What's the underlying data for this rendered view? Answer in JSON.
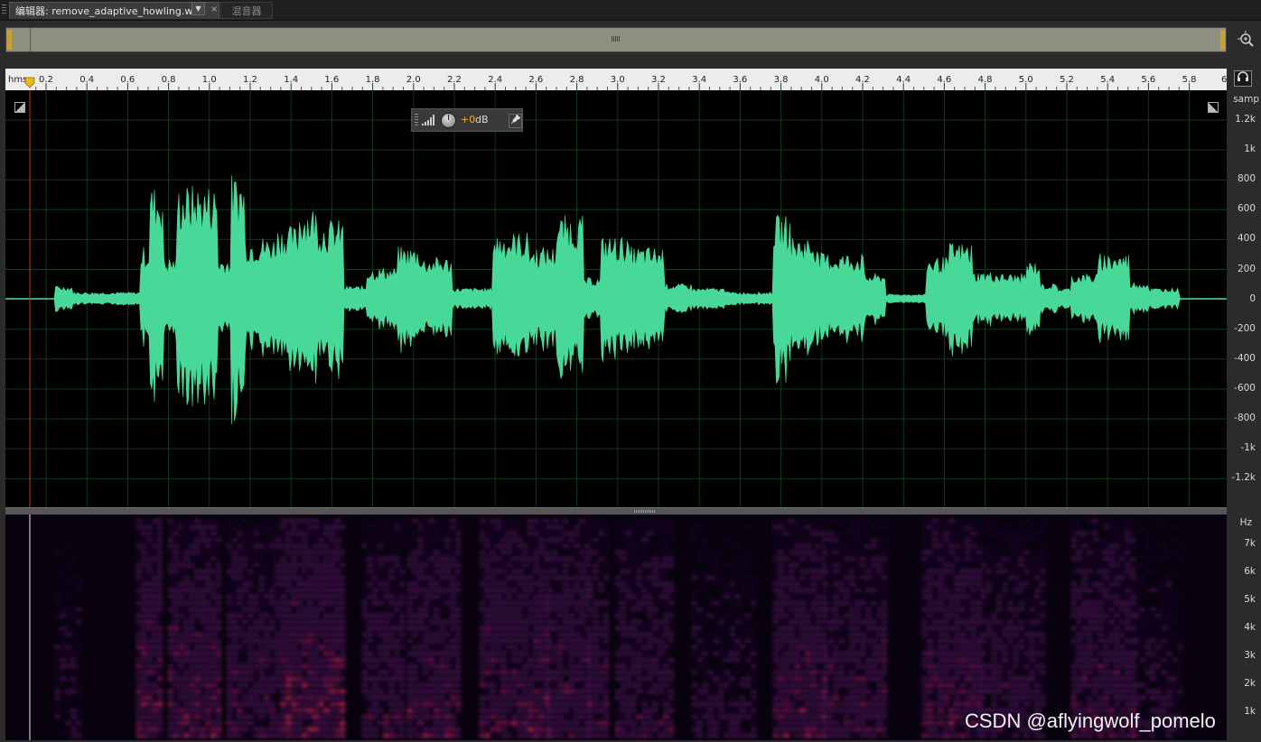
{
  "tabs": {
    "active_label": "编辑器: remove_adaptive_howling.wav",
    "inactive_label": "混音器",
    "dropdown_glyph": "▼",
    "close_glyph": "×"
  },
  "ruler": {
    "unit": "hms",
    "labels": [
      "0.2",
      "0.4",
      "0.6",
      "0.8",
      "1.0",
      "1.2",
      "1.4",
      "1.6",
      "1.8",
      "2.0",
      "2.2",
      "2.4",
      "2.6",
      "2.8",
      "3.0",
      "3.2",
      "3.4",
      "3.6",
      "3.8",
      "4.0",
      "4.2",
      "4.4",
      "4.6",
      "4.8",
      "5.0",
      "5.2",
      "5.4",
      "5.6",
      "5.8"
    ],
    "end_fragment": "6"
  },
  "amplitude_scale": {
    "unit": "samp",
    "labels": [
      "1.2k",
      "1k",
      "800",
      "600",
      "400",
      "200",
      "0",
      "-200",
      "-400",
      "-600",
      "-800",
      "-1k",
      "-1.2k"
    ]
  },
  "frequency_scale": {
    "unit": "Hz",
    "labels": [
      "7k",
      "6k",
      "5k",
      "4k",
      "3k",
      "2k",
      "1k"
    ]
  },
  "hud": {
    "gain_value": "+0",
    "gain_unit": "dB"
  },
  "waveform": {
    "color": "#48d999",
    "playhead_time_s": 0.12
  },
  "spectrogram": {
    "colors": [
      "#2a0a3a",
      "#7a1d8a",
      "#c2247a",
      "#ff3070"
    ]
  },
  "icons": {
    "zoom": "magnifier-icon",
    "monitor": "headphones-icon",
    "hud_pin": "pin-icon"
  },
  "watermark": "CSDN @aflyingwolf_pomelo"
}
